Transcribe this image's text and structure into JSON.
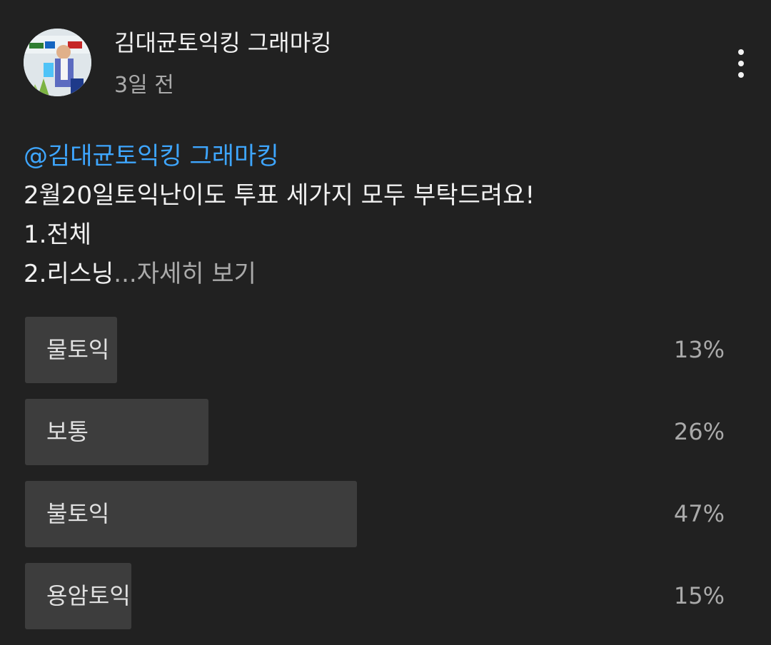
{
  "post": {
    "author_name": "김대균토익킹 그래마킹",
    "timestamp": "3일 전",
    "avatar_icon": "author-avatar",
    "menu_icon": "more-vert-icon",
    "mention": "@김대균토익킹 그래마킹",
    "body_lines": [
      "2월20일토익난이도 투표 세가지 모두 부탁드려요!",
      "1.전체",
      "2.리스닝"
    ],
    "ellipsis": "...",
    "read_more": "자세히 보기"
  },
  "poll": {
    "options": [
      {
        "label": "물토익",
        "percent_text": "13%",
        "percent": 13
      },
      {
        "label": "보통",
        "percent_text": "26%",
        "percent": 26
      },
      {
        "label": "불토익",
        "percent_text": "47%",
        "percent": 47
      },
      {
        "label": "용암토익",
        "percent_text": "15%",
        "percent": 15
      }
    ]
  },
  "colors": {
    "background": "#212121",
    "mention": "#3ea6ff",
    "poll_fill": "#3d3d3d",
    "secondary_text": "#aaaaaa"
  }
}
